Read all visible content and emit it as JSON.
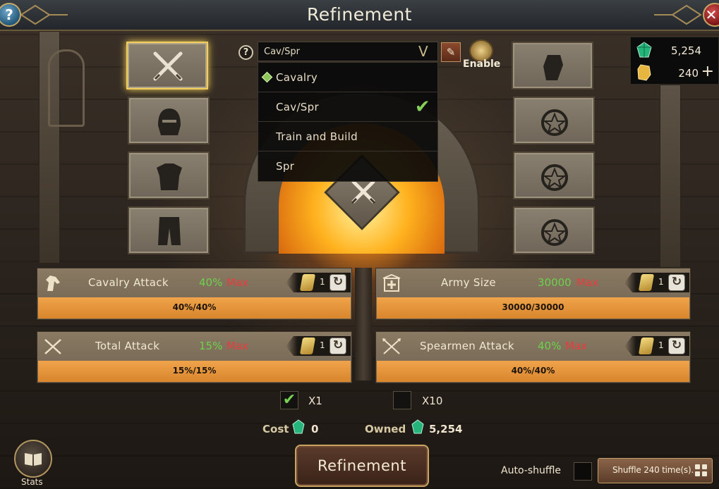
{
  "header": {
    "title": "Refinement",
    "help_icon": "?"
  },
  "dropdown": {
    "help_icon": "?",
    "selected": "Cav/Spr",
    "options": [
      {
        "label": "Cavalry",
        "marker": "diamond"
      },
      {
        "label": "Cav/Spr",
        "checked": true
      },
      {
        "label": "Train and Build"
      },
      {
        "label": "Spr"
      }
    ]
  },
  "enable": {
    "label": "Enable"
  },
  "currency": {
    "gems": "5,254",
    "gold": "240",
    "plus": "+"
  },
  "left_slots": [
    "crossed-swords-icon",
    "helmet-icon",
    "armor-icon",
    "leggings-icon"
  ],
  "right_slots": [
    "gauntlet-icon",
    "pendant-icon",
    "pendant-icon",
    "pendant-icon"
  ],
  "stats": [
    {
      "name": "Cavalry Attack",
      "pct": "40%",
      "max": "Max",
      "bar": "40%/40%",
      "fill": 1.0,
      "lock_count": "1"
    },
    {
      "name": "Army Size",
      "pct": "30000",
      "max": "Max",
      "bar": "30000/30000",
      "fill": 1.0,
      "lock_count": "1"
    },
    {
      "name": "Total Attack",
      "pct": "15%",
      "max": "Max",
      "bar": "15%/15%",
      "fill": 1.0,
      "lock_count": "1"
    },
    {
      "name": "Spearmen Attack",
      "pct": "40%",
      "max": "Max",
      "bar": "40%/40%",
      "fill": 1.0,
      "lock_count": "1"
    }
  ],
  "multiplier": {
    "x1_label": "X1",
    "x1_checked": true,
    "x10_label": "X10",
    "x10_checked": false
  },
  "cost": {
    "label": "Cost",
    "value": "0"
  },
  "owned": {
    "label": "Owned",
    "value": "5,254"
  },
  "actions": {
    "refine_label": "Refinement",
    "stats_label": "Stats",
    "auto_shuffle_label": "Auto-shuffle",
    "shuffle_label": "Shuffle 240 time(s)."
  },
  "colors": {
    "accent_green": "#6dd14d",
    "max_red": "#ea3c3c",
    "bar_orange": "#e39536",
    "gold_border": "#c9a361"
  }
}
